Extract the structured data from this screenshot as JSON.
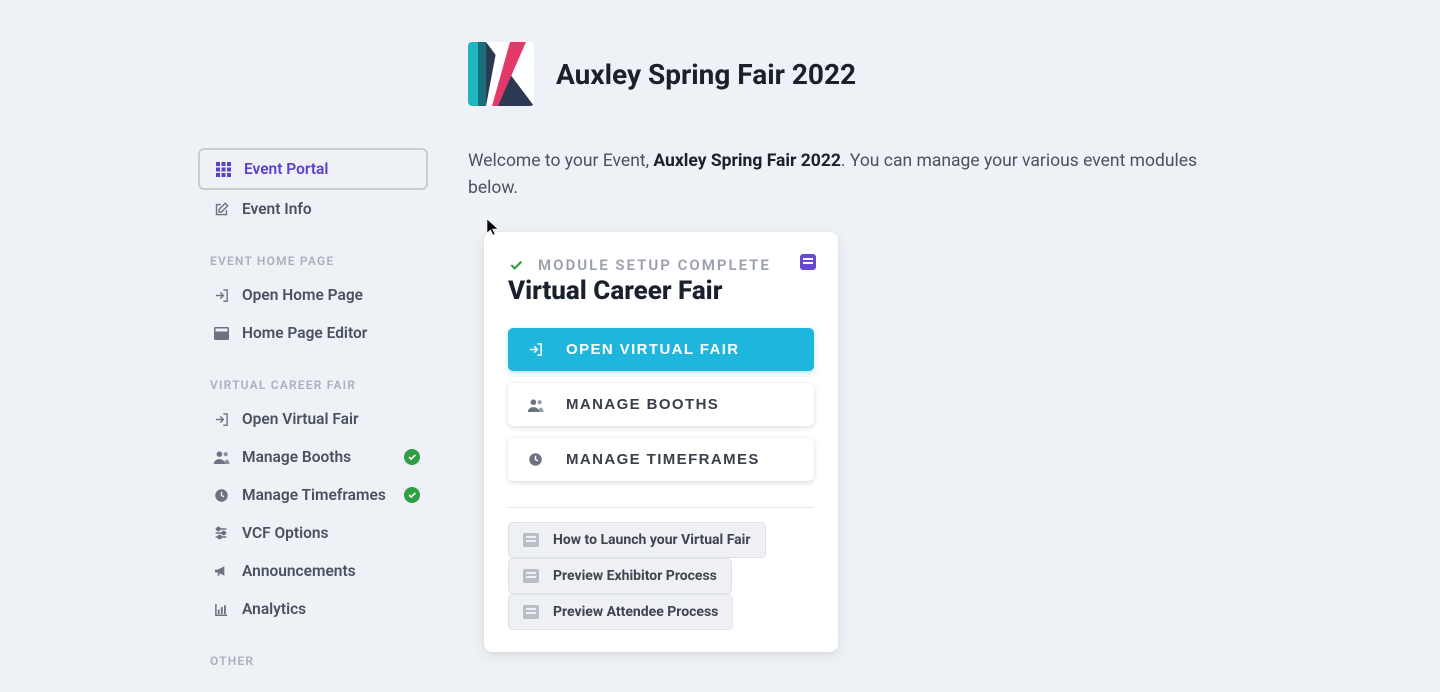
{
  "header": {
    "title": "Auxley Spring Fair 2022"
  },
  "intro": {
    "prefix": "Welcome to your Event, ",
    "event_name": "Auxley Spring Fair 2022",
    "suffix": ". You can manage your various event modules below."
  },
  "sidebar": {
    "top": [
      {
        "label": "Event Portal"
      },
      {
        "label": "Event Info"
      }
    ],
    "sections": [
      {
        "heading": "EVENT HOME PAGE",
        "items": [
          {
            "label": "Open Home Page"
          },
          {
            "label": "Home Page Editor"
          }
        ]
      },
      {
        "heading": "VIRTUAL CAREER FAIR",
        "items": [
          {
            "label": "Open Virtual Fair"
          },
          {
            "label": "Manage Booths"
          },
          {
            "label": "Manage Timeframes"
          },
          {
            "label": "VCF Options"
          },
          {
            "label": "Announcements"
          },
          {
            "label": "Analytics"
          }
        ]
      },
      {
        "heading": "OTHER",
        "items": []
      }
    ]
  },
  "card": {
    "status": "MODULE SETUP COMPLETE",
    "title": "Virtual Career Fair",
    "primary_button": "OPEN VIRTUAL FAIR",
    "secondary_buttons": [
      "MANAGE BOOTHS",
      "MANAGE TIMEFRAMES"
    ],
    "pills": [
      "How to Launch your Virtual Fair",
      "Preview Exhibitor Process",
      "Preview Attendee Process"
    ]
  }
}
